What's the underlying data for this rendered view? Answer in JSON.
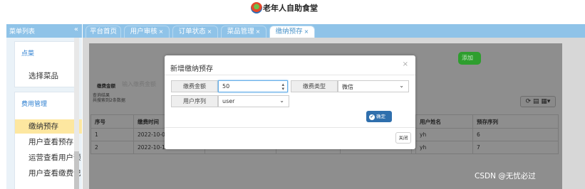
{
  "header": {
    "app_title": "老年人自助食堂",
    "logo_icon": "canteen-logo-icon"
  },
  "sidebar": {
    "title": "菜单列表",
    "collapse_label": "«",
    "groups": [
      {
        "title": "点菜",
        "items": [
          "选择菜品"
        ]
      },
      {
        "title": "费用管理",
        "items": [
          "缴纳预存",
          "用户查看预存",
          "运营查看用户预",
          "用户查看缴费记"
        ]
      }
    ],
    "active_item": "缴纳预存"
  },
  "tabs": [
    {
      "label": "平台首页",
      "close": ""
    },
    {
      "label": "用户审核",
      "close": "×"
    },
    {
      "label": "订单状态",
      "close": "×"
    },
    {
      "label": "菜品管理",
      "close": "×"
    },
    {
      "label": "缴纳预存",
      "close": "×",
      "active": true
    }
  ],
  "page": {
    "add_button": "添加",
    "search_label": "缴费金额",
    "search_placeholder": "输入缴费金额",
    "query_result_line1": "查询结果",
    "query_result_line2": "共搜索到2条数据",
    "toolbar_icons": "⟳ ▤ ▦▾",
    "table": {
      "headers": [
        "序号",
        "缴费时间",
        "",
        "",
        "",
        "",
        "用户姓名",
        "预存序列"
      ],
      "rows": [
        [
          "1",
          "2022-10-0",
          "",
          "",
          "",
          "",
          "yh",
          "6"
        ],
        [
          "2",
          "2022-10-1",
          "",
          "",
          "",
          "",
          "yh",
          "7"
        ]
      ]
    }
  },
  "modal": {
    "title": "新增缴纳预存",
    "close_label": "×",
    "amount_label": "缴费金额",
    "amount_value": "50",
    "type_label": "缴费类型",
    "type_value": "微信",
    "sequence_label": "用户序列",
    "sequence_value": "user",
    "confirm_label": "确定",
    "close_button_label": "关闭"
  },
  "watermark": "CSDN @无忧必过"
}
